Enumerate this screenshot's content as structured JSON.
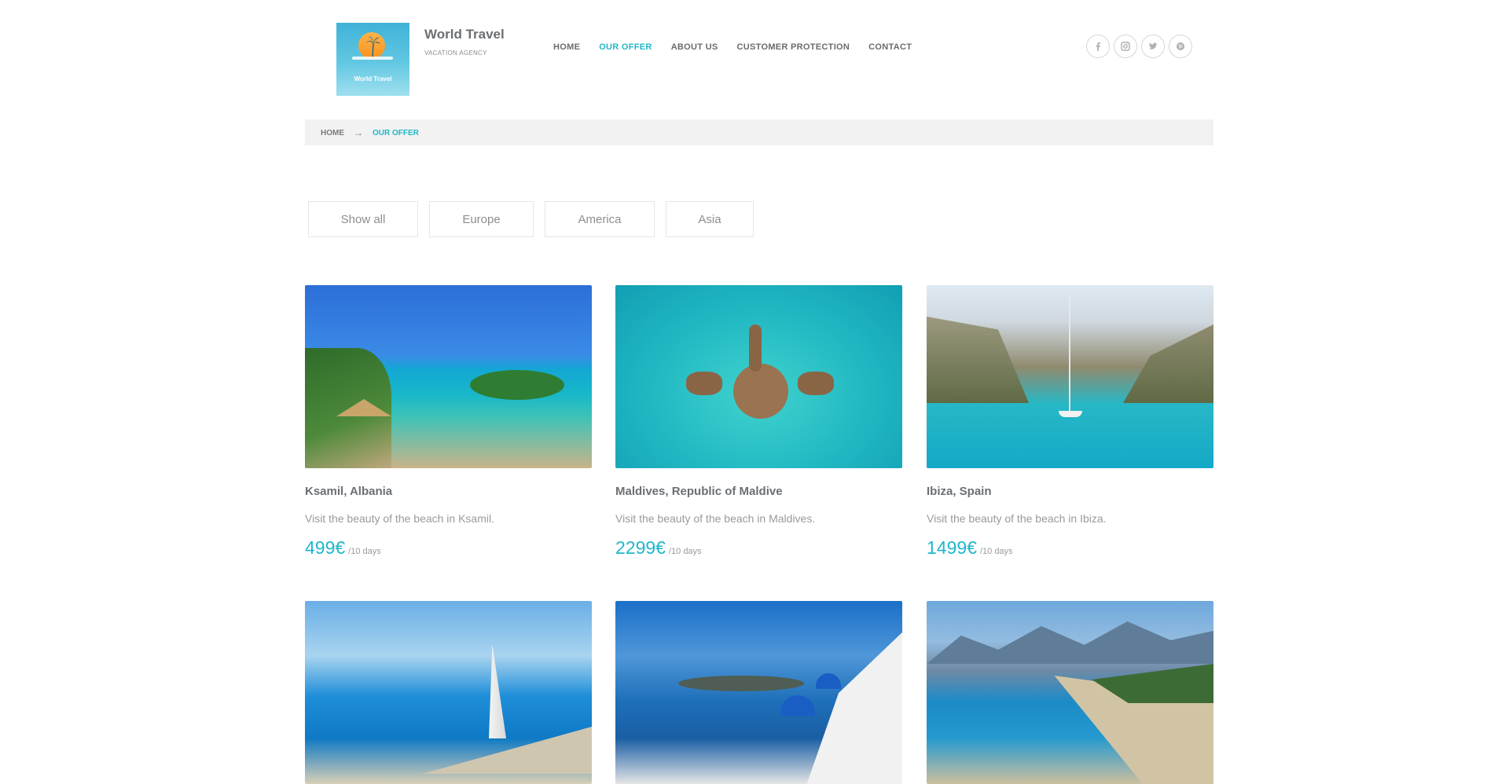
{
  "brand": {
    "title": "World Travel",
    "subtitle": "VACATION AGENCY",
    "logo_text": "World Travel"
  },
  "nav": {
    "items": [
      "HOME",
      "OUR OFFER",
      "ABOUT US",
      "CUSTOMER PROTECTION",
      "CONTACT"
    ],
    "active": "OUR OFFER"
  },
  "social": [
    "facebook-icon",
    "instagram-icon",
    "twitter-icon",
    "pinterest-icon"
  ],
  "breadcrumb": {
    "home": "HOME",
    "separator": "→",
    "current": "OUR OFFER"
  },
  "filters": [
    "Show all",
    "Europe",
    "America",
    "Asia"
  ],
  "offers": [
    {
      "title": "Ksamil, Albania",
      "desc": "Visit the beauty of the beach in Ksamil.",
      "price": "499€",
      "period": "/10 days"
    },
    {
      "title": "Maldives, Republic of Maldive",
      "desc": "Visit the beauty of the beach in Maldives.",
      "price": "2299€",
      "period": "/10 days"
    },
    {
      "title": "Ibiza, Spain",
      "desc": "Visit the beauty of the beach in Ibiza.",
      "price": "1499€",
      "period": "/10 days"
    }
  ],
  "colors": {
    "accent": "#20b7c9",
    "text": "#6b6f73",
    "breadcrumb_bg": "#f2f2f2"
  }
}
